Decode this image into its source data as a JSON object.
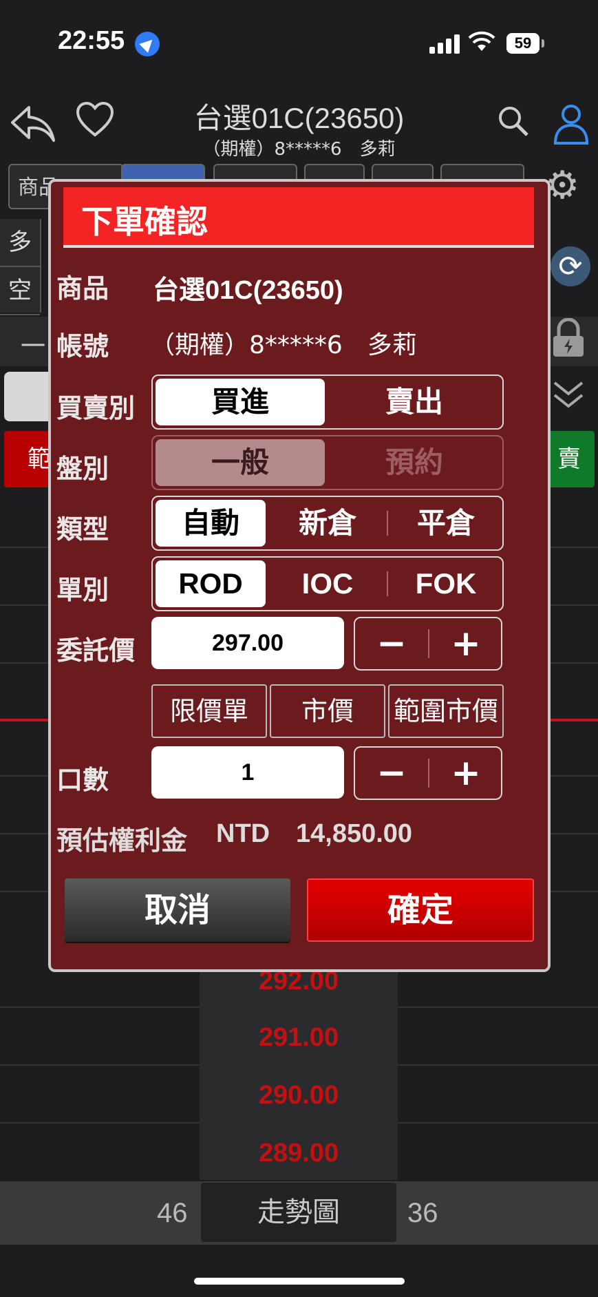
{
  "status_bar": {
    "time": "22:55",
    "battery": "59"
  },
  "header": {
    "title": "台選01C(23650)",
    "subtitle": "（期權）8*****6　多莉"
  },
  "background": {
    "tabs": [
      "商品",
      "",
      "",
      "",
      "",
      ""
    ],
    "left_col": [
      "多",
      "空"
    ],
    "row_label": "一",
    "red_button": "範",
    "green_button": "賣",
    "prices": [
      "292.00",
      "291.00",
      "290.00",
      "289.00"
    ],
    "bottom": {
      "left_num": "46",
      "trend_label": "走勢圖",
      "right_num": "36"
    }
  },
  "dialog": {
    "title": "下單確認",
    "product_label": "商品",
    "product_value": "台選01C(23650)",
    "account_label": "帳號",
    "account_value": "（期權）8*****6　多莉",
    "side_label": "買賣別",
    "side_options": [
      "買進",
      "賣出"
    ],
    "order_kind_label": "盤別",
    "order_kind_options": [
      "一般",
      "預約"
    ],
    "type_label": "類型",
    "type_options": [
      "自動",
      "新倉",
      "平倉"
    ],
    "tif_label": "單別",
    "tif_options": [
      "ROD",
      "IOC",
      "FOK"
    ],
    "price_label": "委託價",
    "price_value": "297.00",
    "minus": "−",
    "plus": "+",
    "price_types": [
      "限價單",
      "市價",
      "範圍市價"
    ],
    "qty_label": "口數",
    "qty_value": "1",
    "premium_label": "預估權利金",
    "premium_currency": "NTD",
    "premium_value": "14,850.00",
    "cancel_label": "取消",
    "confirm_label": "確定"
  }
}
